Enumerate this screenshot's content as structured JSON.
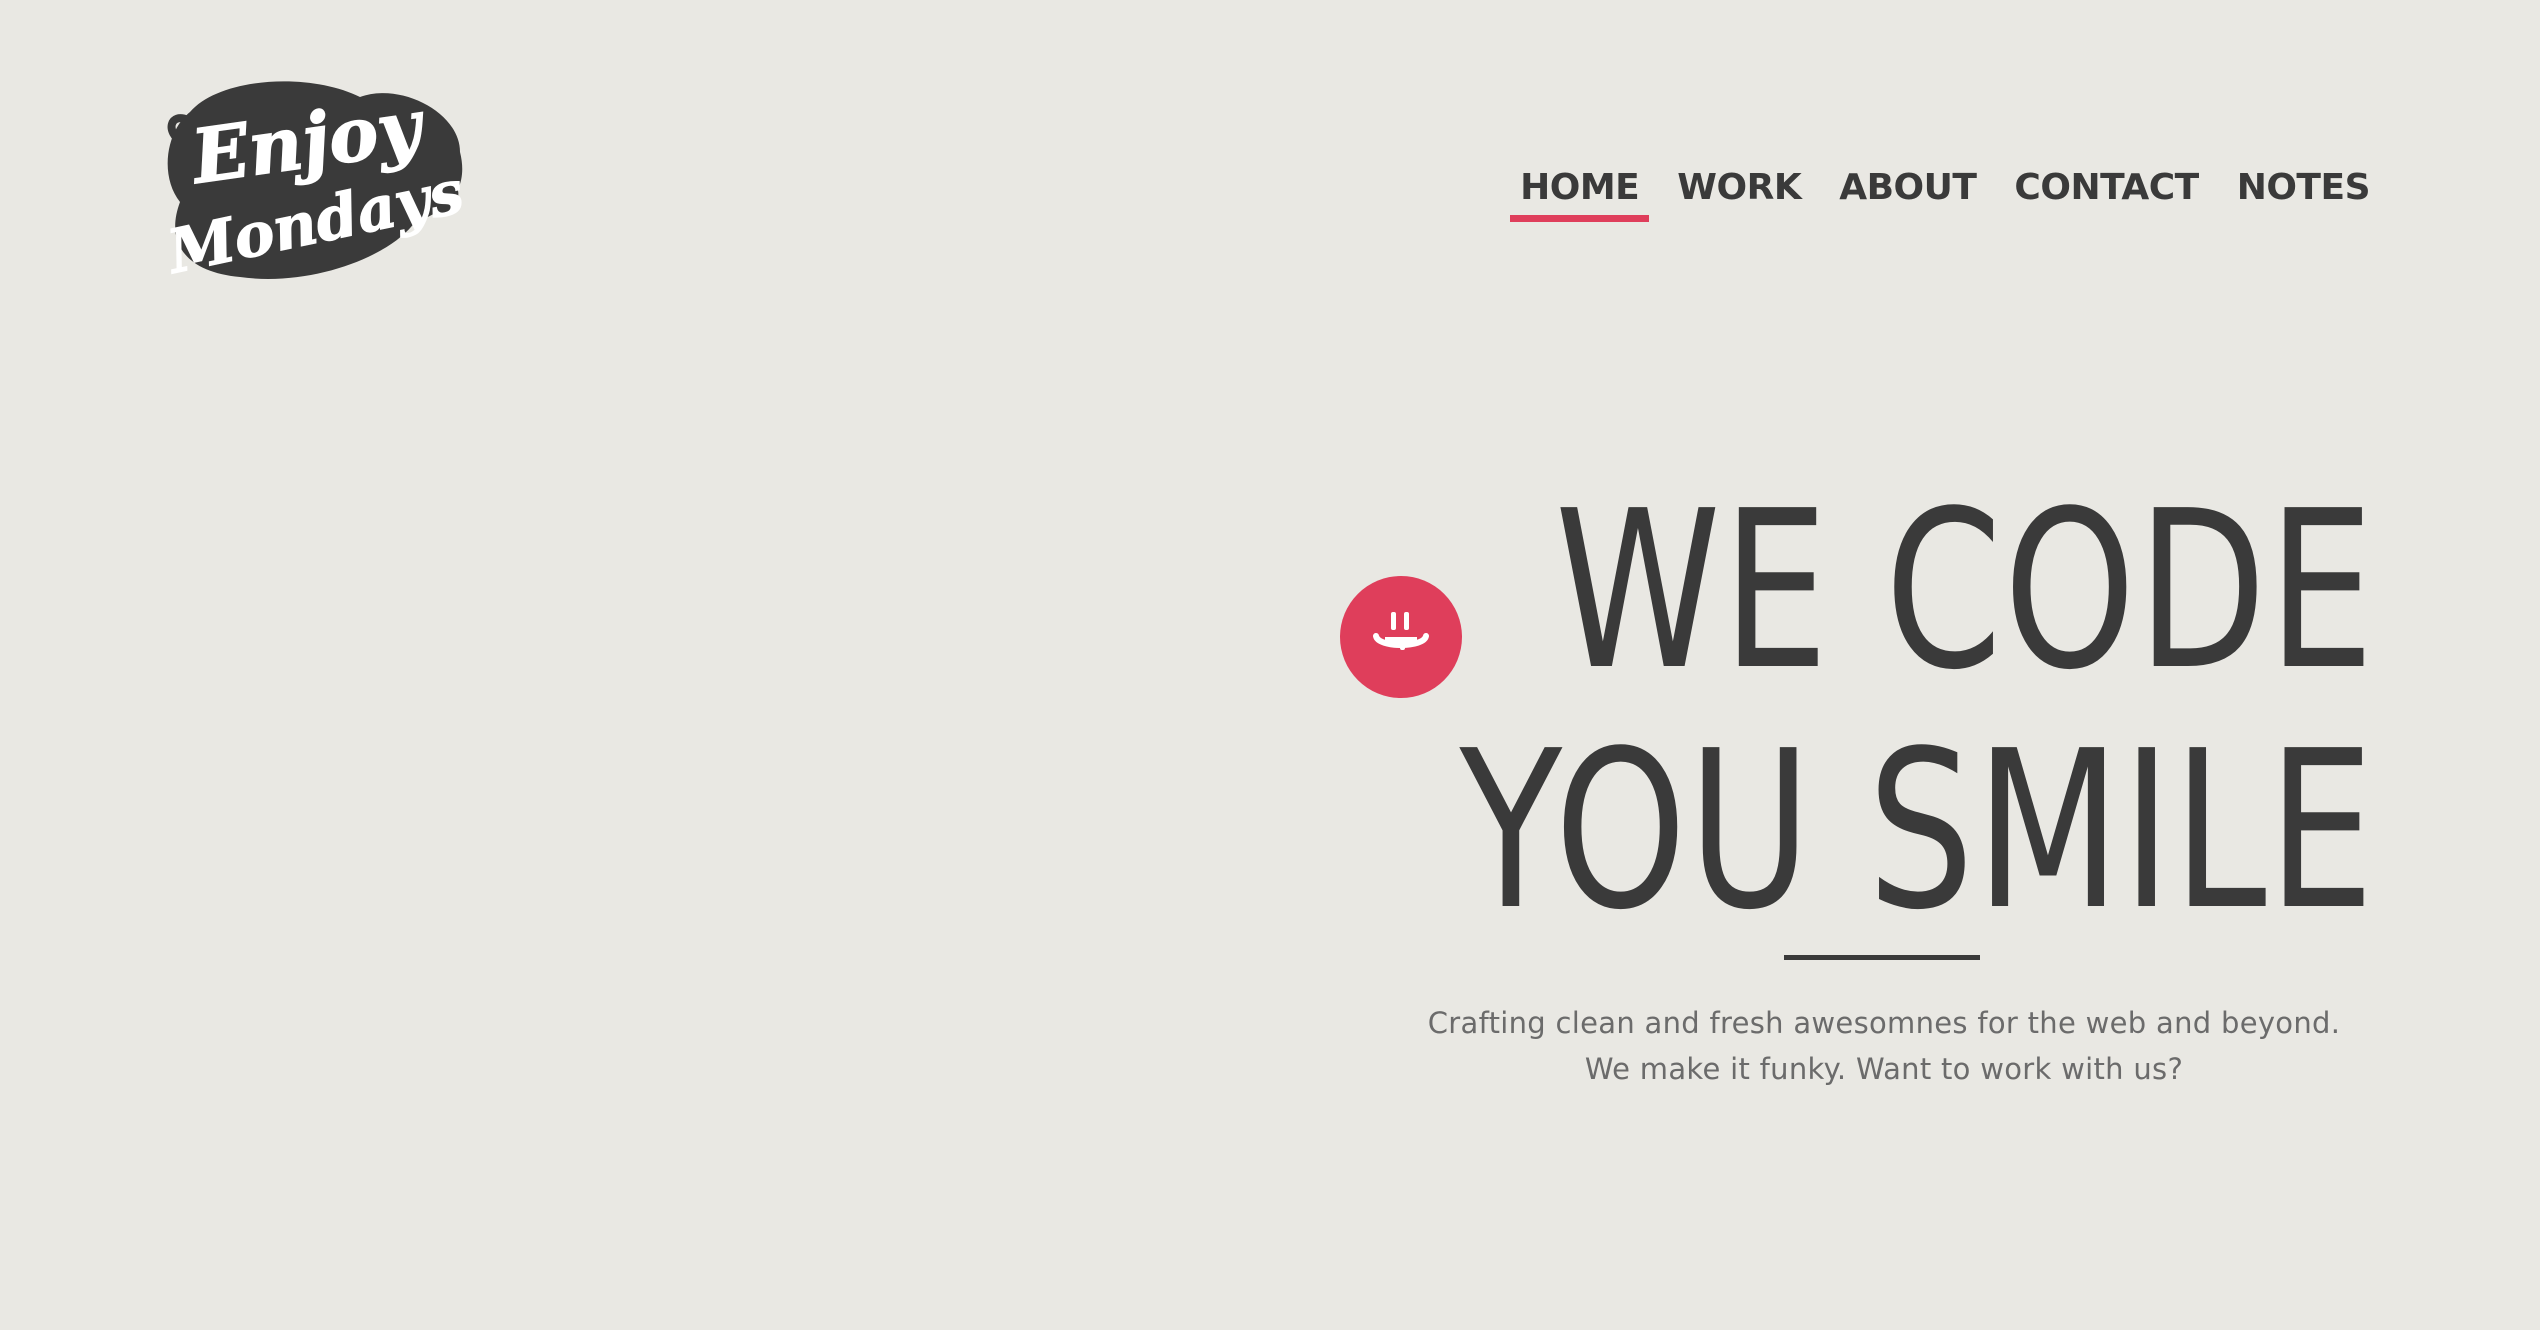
{
  "logo": {
    "text_line1": "Enjoy",
    "text_line2": "Mondays"
  },
  "nav": {
    "items": [
      {
        "label": "HOME",
        "active": true
      },
      {
        "label": "WORK",
        "active": false
      },
      {
        "label": "ABOUT",
        "active": false
      },
      {
        "label": "CONTACT",
        "active": false
      },
      {
        "label": "NOTES",
        "active": false
      }
    ]
  },
  "hero": {
    "line1": "WE CODE",
    "line2": "YOU SMILE",
    "badge_icon": "smiley-icon",
    "tagline_line1": "Crafting clean and fresh awesomnes for the web and beyond.",
    "tagline_line2": "We make it funky. Want to work with us?"
  },
  "colors": {
    "background": "#e9e8e3",
    "text": "#3a3a3a",
    "accent": "#df3e5b",
    "muted": "#6b6b6b"
  }
}
